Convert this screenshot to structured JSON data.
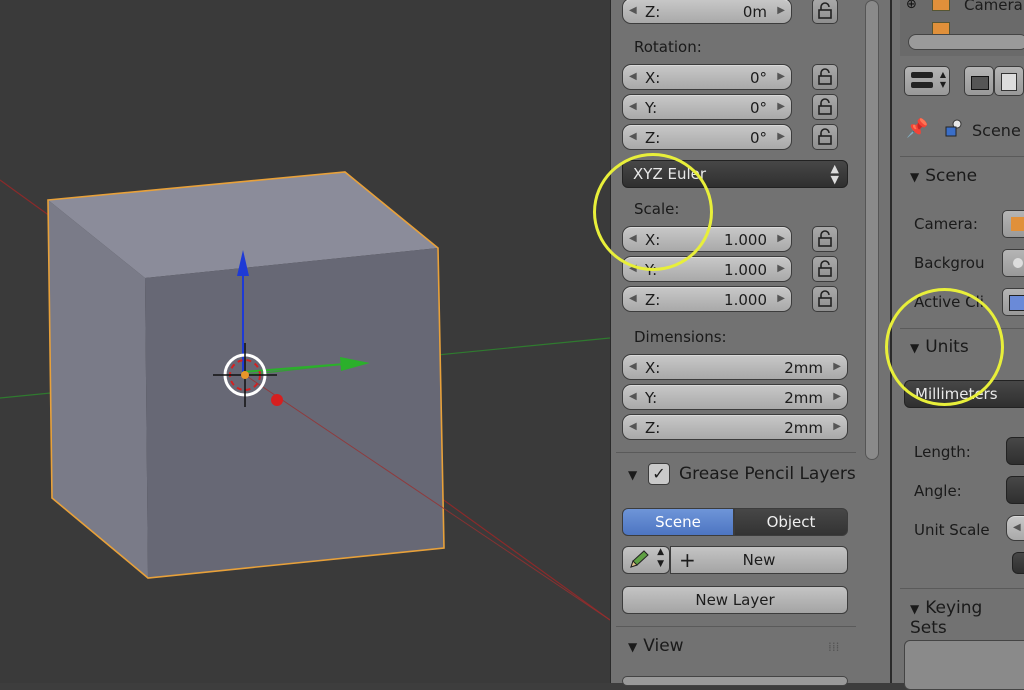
{
  "top_partial": {
    "label": "Z:",
    "value": "0m"
  },
  "rotation": {
    "heading": "Rotation:",
    "fields": [
      {
        "label": "X:",
        "value": "0°"
      },
      {
        "label": "Y:",
        "value": "0°"
      },
      {
        "label": "Z:",
        "value": "0°"
      }
    ],
    "mode": "XYZ Euler"
  },
  "scale": {
    "heading": "Scale:",
    "fields": [
      {
        "label": "X:",
        "value": "1.000"
      },
      {
        "label": "Y:",
        "value": "1.000"
      },
      {
        "label": "Z:",
        "value": "1.000"
      }
    ]
  },
  "dimensions": {
    "heading": "Dimensions:",
    "fields": [
      {
        "label": "X:",
        "value": "2mm"
      },
      {
        "label": "Y:",
        "value": "2mm"
      },
      {
        "label": "Z:",
        "value": "2mm"
      }
    ]
  },
  "grease_pencil": {
    "title": "Grease Pencil Layers",
    "enabled": true,
    "tab_scene": "Scene",
    "tab_object": "Object",
    "new_label": "New",
    "new_layer_label": "New Layer"
  },
  "view_section": {
    "title": "View"
  },
  "properties": {
    "outliner_item": "Camera",
    "context_label": "Scene",
    "section_scene": "Scene",
    "camera_label": "Camera:",
    "background_label": "Backgrou",
    "active_clip_label": "Active Cli",
    "section_units": "Units",
    "units_value": "Millimeters",
    "length_label": "Length:",
    "angle_label": "Angle:",
    "unit_scale_label": "Unit Scale",
    "section_keying": "Keying Sets"
  },
  "colors": {
    "selection_outline": "#e8a13a",
    "highlight_circle": "#e8ef3a",
    "active_tab": "#5a82cc",
    "axis_x": "#b03030",
    "axis_y": "#3aa03a",
    "axis_z": "#2040d0"
  }
}
